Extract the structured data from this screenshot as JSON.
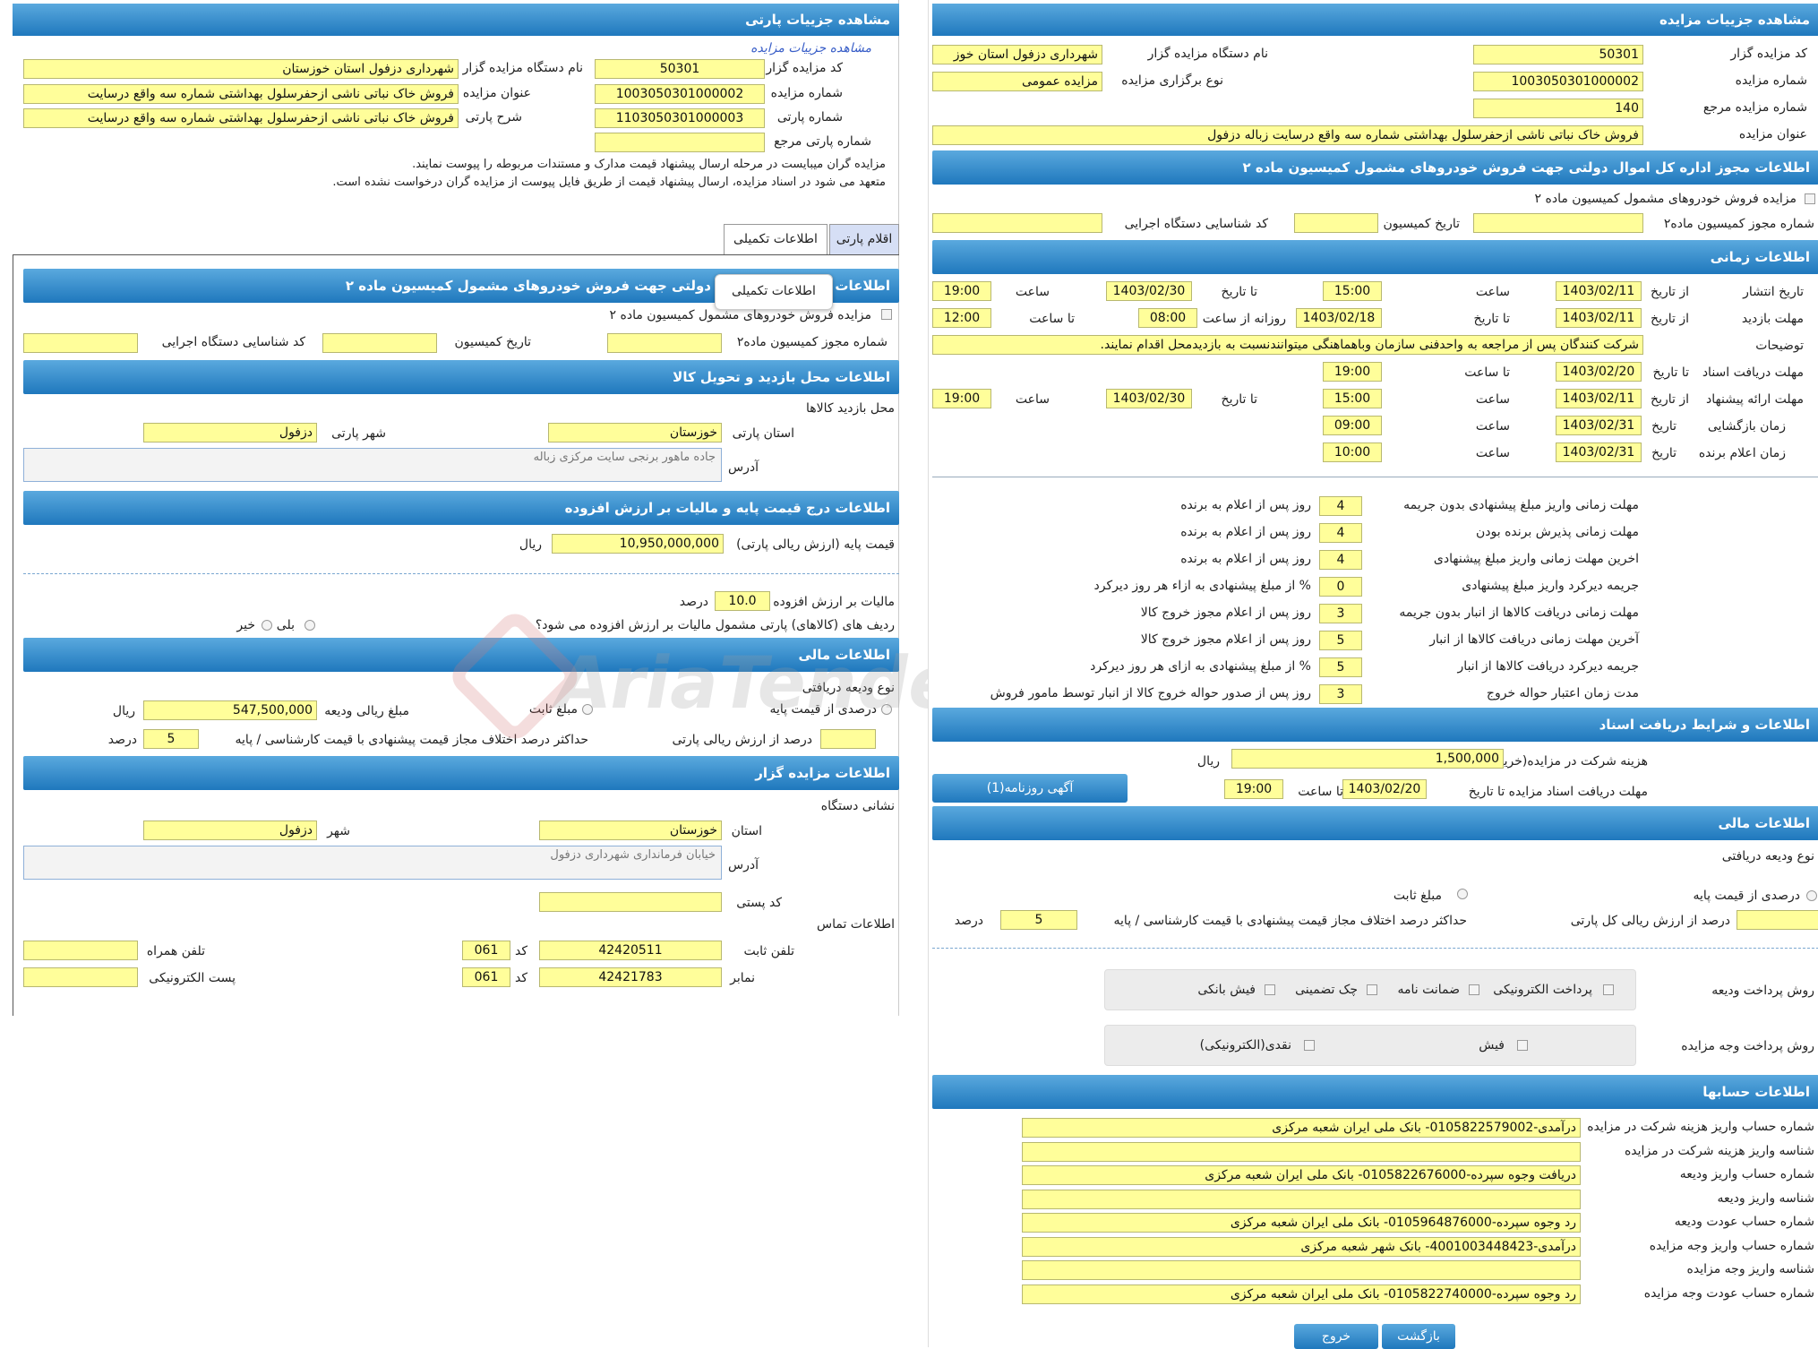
{
  "left": {
    "title": "مشاهده جزییات پارتی",
    "breadcrumb": "مشاهده جزییات مزایده",
    "fields": {
      "auctioneer_code_label": "کد مزایده گزار",
      "auctioneer_code": "50301",
      "auctioneer_name_label": "نام دستگاه مزایده گزار",
      "auctioneer_name": "شهرداری دزفول استان خوزستان",
      "auction_number_label": "شماره مزایده",
      "auction_number": "1003050301000002",
      "auction_title_label": "عنوان مزایده",
      "auction_title": "فروش خاک نباتی ناشی ازحفرسلول بهداشتی شماره سه واقع درسایت",
      "party_number_label": "شماره پارتی",
      "party_number": "1103050301000003",
      "party_desc_label": "شرح پارتی",
      "party_desc": "فروش خاک نباتی ناشی ازحفرسلول بهداشتی شماره سه واقع درسایت",
      "party_ref_label": "شماره پارتی مرجع",
      "party_ref": ""
    },
    "notes": [
      "مزایده گران میبایست در مرحله ارسال پیشنهاد قیمت مدارک و مستندات مربوطه را پیوست نمایند.",
      "متعهد می شود در اسناد مزایده، ارسال پیشنهاد قیمت از طریق فایل پیوست از مزایده گران درخواست نشده است."
    ],
    "tabs": {
      "items": "اقلام پارتی",
      "extra": "اطلاعات تکمیلی"
    },
    "tooltip": "اطلاعات تکمیلی",
    "section1": {
      "title": "اطلاعات مجوز اداره کل اموال دولتی جهت فروش خودروهای مشمول کمیسیون ماده ۲",
      "title_visible": "اطلاعات م",
      "title_rest": "دولتی جهت فروش خودروهای مشمول کمیسیون ماده ۲",
      "checkbox_label": "مزایده فروش خودروهای مشمول کمیسیون ماده ۲",
      "permit_label": "شماره مجوز کمیسیون ماده۲",
      "commission_date_label": "تاریخ کمیسیون",
      "exec_id_label": "کد شناسایی دستگاه اجرایی"
    },
    "section2": {
      "title": "اطلاعات محل بازدید و تحویل کالا",
      "visit_place_label": "محل بازدید کالاها",
      "province_label": "استان پارتی",
      "province": "خوزستان",
      "city_label": "شهر پارتی",
      "city": "دزفول",
      "address_label": "آدرس",
      "address": "جاده ماهور برنجی سایت مرکزی زباله"
    },
    "section3": {
      "title": "اطلاعات درج قیمت پایه و مالیات بر ارزش افزوده",
      "base_price_label": "قیمت پایه (ارزش ریالی پارتی)",
      "base_price": "10,950,000,000",
      "rial": "ریال",
      "vat_label": "مالیات بر ارزش افزوده",
      "vat": "10.0",
      "percent": "درصد",
      "vat_question": "ردیف های (کالاهای) پارتی مشمول مالیات بر ارزش افزوده می شود؟",
      "yes": "بلی",
      "no": "خیر"
    },
    "section4": {
      "title": "اطلاعات مالی",
      "deposit_type_label": "نوع ودیعه دریافتی",
      "percent_of_base": "درصدی از قیمت پایه",
      "fixed_amount": "مبلغ ثابت",
      "deposit_amount_label": "مبلغ ریالی ودیعه",
      "deposit_amount": "547,500,000",
      "rial": "ریال",
      "percent_of_party_label": "درصد از ارزش ریالی پارتی",
      "max_diff_label": "حداکثر درصد اختلاف مجاز قیمت پیشنهادی با قیمت کارشناسی / پایه",
      "max_diff": "5",
      "percent": "درصد"
    },
    "section5": {
      "title": "اطلاعات مزایده گزار",
      "address_header": "نشانی دستگاه",
      "province_label": "استان",
      "province": "خوزستان",
      "city_label": "شهر",
      "city": "دزفول",
      "address_label": "آدرس",
      "address": "خیابان فرمانداری شهرداری دزفول",
      "postal_label": "کد پستی",
      "contact_header": "اطلاعات تماس",
      "phone_label": "تلفن ثابت",
      "phone": "42420511",
      "code_label": "کد",
      "phone_code": "061",
      "mobile_label": "تلفن همراه",
      "fax_label": "نمابر",
      "fax": "42421783",
      "fax_code": "061",
      "email_label": "پست الکترونیکی"
    }
  },
  "right": {
    "title": "مشاهده جزییات مزایده",
    "fields": {
      "auctioneer_code_label": "کد مزایده گزار",
      "auctioneer_code": "50301",
      "auctioneer_name_label": "نام دستگاه مزایده گزار",
      "auctioneer_name": "شهرداری دزفول استان خوز",
      "auction_number_label": "شماره مزایده",
      "auction_number": "1003050301000002",
      "holding_type_label": "نوع برگزاری مزایده",
      "holding_type": "مزایده عمومی",
      "ref_number_label": "شماره مزایده مرجع",
      "ref_number": "140",
      "title_label": "عنوان مزایده",
      "title": "فروش خاک نباتی ناشی ازحفرسلول بهداشتی شماره سه واقع درسایت زباله دزفول"
    },
    "permit": {
      "title": "اطلاعات مجوز اداره کل اموال دولتی جهت فروش خودروهای مشمول کمیسیون ماده ۲",
      "checkbox_label": "مزایده فروش خودروهای مشمول کمیسیون ماده ۲",
      "permit_label": "شماره مجوز کمیسیون ماده۲",
      "commission_date_label": "تاریخ کمیسیون",
      "exec_id_label": "کد شناسایی دستگاه اجرایی"
    },
    "timing": {
      "title": "اطلاعات زمانی",
      "publish_label": "تاریخ انتشار",
      "from_date": "از تاریخ",
      "to_date": "تا تاریخ",
      "to_date2": "تا تاریخ",
      "hour": "ساعت",
      "to_hour": "تا ساعت",
      "daily_from": "روزانه از ساعت",
      "publish_from": "1403/02/11",
      "publish_from_time": "15:00",
      "publish_to": "1403/02/30",
      "publish_to_time": "19:00",
      "visit_label": "مهلت بازدید",
      "visit_from": "1403/02/11",
      "visit_to": "1403/02/18",
      "visit_from_time": "08:00",
      "visit_to_time": "12:00",
      "desc_label": "توضیحات",
      "desc": "شرکت کنندگان پس از مراجعه به واحدفنی سازمان وباهماهنگی میتوانندنسبت به بازدیدمحل اقدام نمایند.",
      "doc_receive_label": "مهلت دریافت اسناد",
      "doc_to": "1403/02/20",
      "doc_to_time": "19:00",
      "offer_label": "مهلت ارائه پیشنهاد",
      "offer_from": "1403/02/11",
      "offer_from_time": "15:00",
      "offer_to": "1403/02/30",
      "offer_to_time": "19:00",
      "opening_label": "زمان بازگشایی",
      "date": "تاریخ",
      "opening_date": "1403/02/31",
      "opening_time": "09:00",
      "winner_label": "زمان اعلام برنده",
      "winner_date": "1403/02/31",
      "winner_time": "10:00"
    },
    "deadlines": [
      {
        "label": "مهلت زمانی واریز مبلغ پیشنهادی بدون جریمه",
        "value": "4",
        "unit": "روز پس از اعلام به برنده"
      },
      {
        "label": "مهلت زمانی پذیرش برنده بودن",
        "value": "4",
        "unit": "روز پس از اعلام به برنده"
      },
      {
        "label": "اخرین مهلت زمانی واریز مبلغ پیشنهادی",
        "value": "4",
        "unit": "روز پس از اعلام به برنده"
      },
      {
        "label": "جریمه دیرکرد واریز مبلغ پیشنهادی",
        "value": "0",
        "unit": "% از مبلغ پیشنهادی به ازاء هر روز دیرکرد"
      },
      {
        "label": "مهلت زمانی دریافت کالاها از انبار بدون جریمه",
        "value": "3",
        "unit": "روز پس از اعلام مجوز خروج کالا"
      },
      {
        "label": "آخرین مهلت زمانی دریافت کالاها از انبار",
        "value": "5",
        "unit": "روز پس از اعلام مجوز خروج کالا"
      },
      {
        "label": "جریمه دیرکرد دریافت کالاها از انبار",
        "value": "5",
        "unit": "% از مبلغ پیشنهادی به ازای هر روز دیرکرد"
      },
      {
        "label": "مدت زمان اعتبار حواله خروج",
        "value": "3",
        "unit": "روز پس از صدور حواله خروج کالا از انبار توسط مامور فروش"
      }
    ],
    "docs": {
      "title": "اطلاعات و شرایط دریافت اسناد",
      "fee_label": "هزینه شرکت در مزایده(خرید اسناد)",
      "fee": "1,500,000",
      "rial": "ریال",
      "deadline_label": "مهلت دریافت اسناد مزایده تا تاریخ",
      "deadline": "1403/02/20",
      "to_hour": "تا ساعت",
      "deadline_time": "19:00",
      "newspaper_button": "آگهی روزنامه(1)"
    },
    "finance": {
      "title": "اطلاعات مالی",
      "deposit_type_label": "نوع ودیعه دریافتی",
      "percent_of_base": "درصدی از قیمت پایه",
      "fixed_amount": "مبلغ ثابت",
      "percent_of_total_label": "درصد از ارزش ریالی کل پارتی",
      "max_diff_label": "حداکثر درصد اختلاف مجاز قیمت پیشنهادی با قیمت کارشناسی / پایه",
      "max_diff": "5",
      "percent": "درصد",
      "deposit_method_label": "روش پرداخت ودیعه",
      "deposit_methods": [
        "پرداخت الکترونیکی",
        "ضمانت نامه",
        "چک تضمینی",
        "فیش بانکی"
      ],
      "payment_method_label": "روش پرداخت وجه مزایده",
      "payment_methods": [
        "فیش",
        "نقدی(الکترونیکی)"
      ]
    },
    "accounts": {
      "title": "اطلاعات حسابها",
      "rows": [
        {
          "label": "شماره حساب واریز هزینه شرکت در مزایده",
          "value": "درآمدی-0105822579002- بانک ملی ایران شعبه مرکزی"
        },
        {
          "label": "شناسه واریز هزینه شرکت در مزایده",
          "value": ""
        },
        {
          "label": "شماره حساب واریز ودیعه",
          "value": "دریافت وجوه سپرده-0105822676000- بانک ملی ایران شعبه مرکزی"
        },
        {
          "label": "شناسه واریز ودیعه",
          "value": ""
        },
        {
          "label": "شماره حساب عودت ودیعه",
          "value": "رد وجوه سپرده-0105964876000- بانک ملی ایران شعبه مرکزی"
        },
        {
          "label": "شماره حساب واریز وجه مزایده",
          "value": "درآمدی-4001003448423- بانک شهر شعبه مرکزی"
        },
        {
          "label": "شناسه واریز وجه مزایده",
          "value": ""
        },
        {
          "label": "شماره حساب عودت وجه مزایده",
          "value": "رد وجوه سپرده-0105822740000- بانک ملی ایران شعبه مرکزی"
        }
      ]
    },
    "buttons": {
      "back": "بازگشت",
      "exit": "خروج"
    }
  },
  "watermark": "AriaTender.neT",
  "colors": {
    "header_top": "#5aa9de",
    "header_bottom": "#1f78bd",
    "field": "#fffe9a"
  }
}
